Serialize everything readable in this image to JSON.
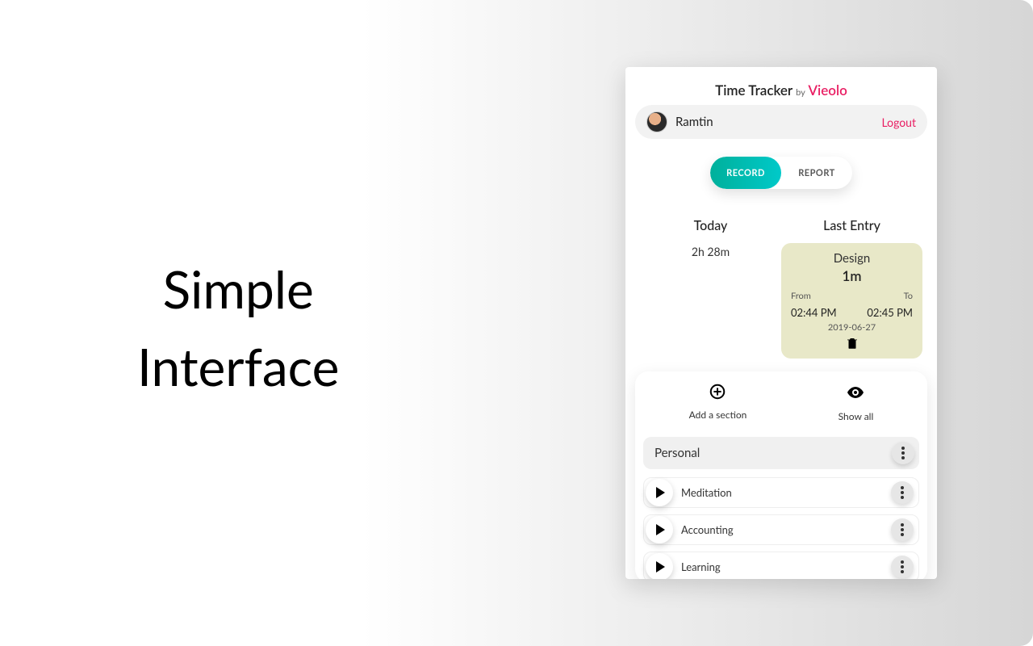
{
  "left_heading_line1": "Simple",
  "left_heading_line2": "Interface",
  "app": {
    "title_main": "Time Tracker",
    "title_by": "by",
    "title_brand": "Vieolo",
    "user_name": "Ramtin",
    "logout_label": "Logout",
    "tabs": {
      "record": "RECORD",
      "report": "REPORT"
    },
    "today": {
      "label": "Today",
      "value": "2h 28m"
    },
    "last_entry": {
      "label": "Last Entry",
      "title": "Design",
      "duration": "1m",
      "from_label": "From",
      "to_label": "To",
      "from_time": "02:44 PM",
      "to_time": "02:45 PM",
      "date": "2019-06-27"
    },
    "panel": {
      "add_label": "Add a section",
      "showall_label": "Show all",
      "section_name": "Personal",
      "items": [
        {
          "name": "Meditation"
        },
        {
          "name": "Accounting"
        },
        {
          "name": "Learning"
        }
      ]
    }
  }
}
